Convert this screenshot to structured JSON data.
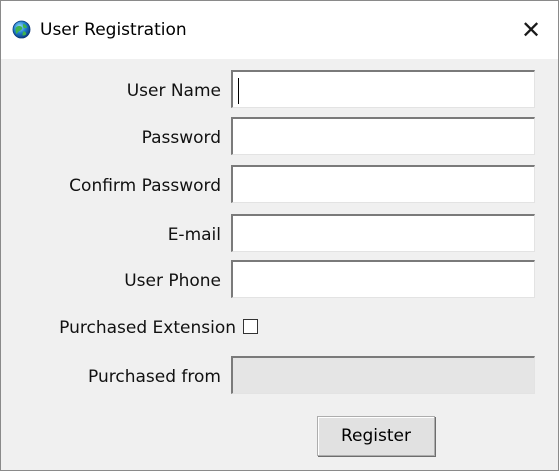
{
  "window": {
    "title": "User Registration",
    "app_icon": "globe-icon",
    "close_icon": "close-icon",
    "close_glyph": "✕"
  },
  "form": {
    "user_name_label": "User Name",
    "password_label": "Password",
    "confirm_password_label": "Confirm Password",
    "email_label": "E-mail",
    "user_phone_label": "User Phone",
    "purchased_extension_label": "Purchased Extension",
    "purchased_from_label": "Purchased from",
    "user_name_value": "",
    "password_value": "",
    "confirm_password_value": "",
    "email_value": "",
    "user_phone_value": "",
    "purchased_from_value": "",
    "purchased_extension_checked": false
  },
  "actions": {
    "register_label": "Register"
  }
}
